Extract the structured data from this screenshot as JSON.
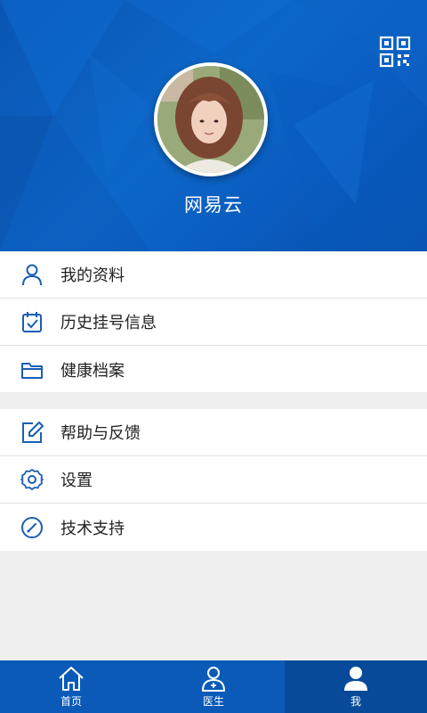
{
  "header": {
    "username": "网易云",
    "qr_icon": "qr-code-icon",
    "avatar_icon": "user-avatar-photo"
  },
  "menu": {
    "group1": [
      {
        "label": "我的资料",
        "icon": "user-icon"
      },
      {
        "label": "历史挂号信息",
        "icon": "calendar-check-icon"
      },
      {
        "label": "健康档案",
        "icon": "folder-icon"
      }
    ],
    "group2": [
      {
        "label": "帮助与反馈",
        "icon": "edit-icon"
      },
      {
        "label": "设置",
        "icon": "gear-icon"
      },
      {
        "label": "技术支持",
        "icon": "gauge-icon"
      }
    ]
  },
  "tabbar": {
    "tabs": [
      {
        "label": "首页",
        "icon": "home-icon",
        "active": false
      },
      {
        "label": "医生",
        "icon": "doctor-icon",
        "active": false
      },
      {
        "label": "我",
        "icon": "person-icon",
        "active": true
      }
    ]
  },
  "colors": {
    "primary": "#0b5ab8",
    "active_tab": "#084a9a",
    "icon_blue": "#1a5fb4",
    "background": "#f0f0f0"
  }
}
